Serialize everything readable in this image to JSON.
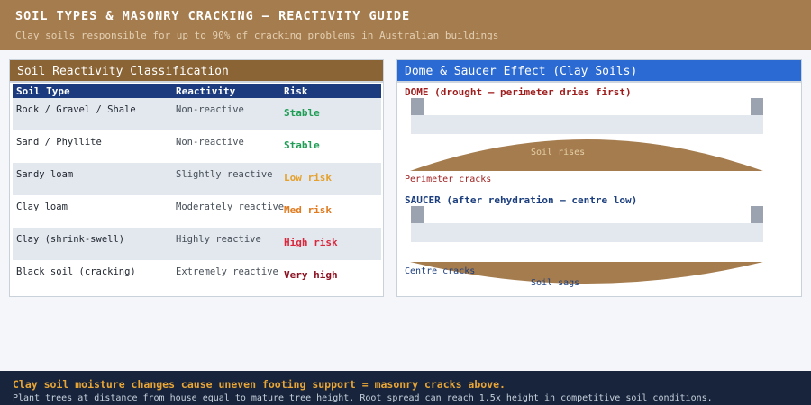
{
  "header": {
    "title": "SOIL TYPES & MASONRY CRACKING – REACTIVITY GUIDE",
    "subtitle": "Clay soils responsible for up to 90% of cracking problems in Australian buildings"
  },
  "classification": {
    "title": "Soil Reactivity Classification",
    "columns": [
      "Soil Type",
      "Reactivity",
      "Risk"
    ],
    "rows": [
      {
        "soil": "Rock / Gravel / Shale",
        "reactivity": "Non-reactive",
        "risk": "Stable",
        "risk_color": "#1f9d55"
      },
      {
        "soil": "Sand / Phyllite",
        "reactivity": "Non-reactive",
        "risk": "Stable",
        "risk_color": "#1f9d55"
      },
      {
        "soil": "Sandy loam",
        "reactivity": "Slightly reactive",
        "risk": "Low risk",
        "risk_color": "#e5a12b"
      },
      {
        "soil": "Clay loam",
        "reactivity": "Moderately reactive",
        "risk": "Med risk",
        "risk_color": "#e07b1f"
      },
      {
        "soil": "Clay (shrink-swell)",
        "reactivity": "Highly reactive",
        "risk": "High risk",
        "risk_color": "#d9263b"
      },
      {
        "soil": "Black soil (cracking)",
        "reactivity": "Extremely reactive",
        "risk": "Very high",
        "risk_color": "#8b1020"
      }
    ]
  },
  "diagram": {
    "title": "Dome & Saucer Effect (Clay Soils)",
    "dome_label": "DOME (drought – perimeter dries first)",
    "dome_soil_label": "Soil rises",
    "dome_crack_label": "Perimeter cracks",
    "saucer_label": "SAUCER (after rehydration – centre low)",
    "saucer_crack_label": "Centre cracks",
    "saucer_soil_label": "Soil sags",
    "colors": {
      "soil": "#a57c4e",
      "slab": "#e3e8ef",
      "pier": "#9aa3af"
    }
  },
  "footer": {
    "main": "Clay soil moisture changes cause uneven footing support = masonry cracks above.",
    "note": "Plant trees at distance from house equal to mature tree height. Root spread can reach 1.5x height in competitive soil conditions."
  }
}
